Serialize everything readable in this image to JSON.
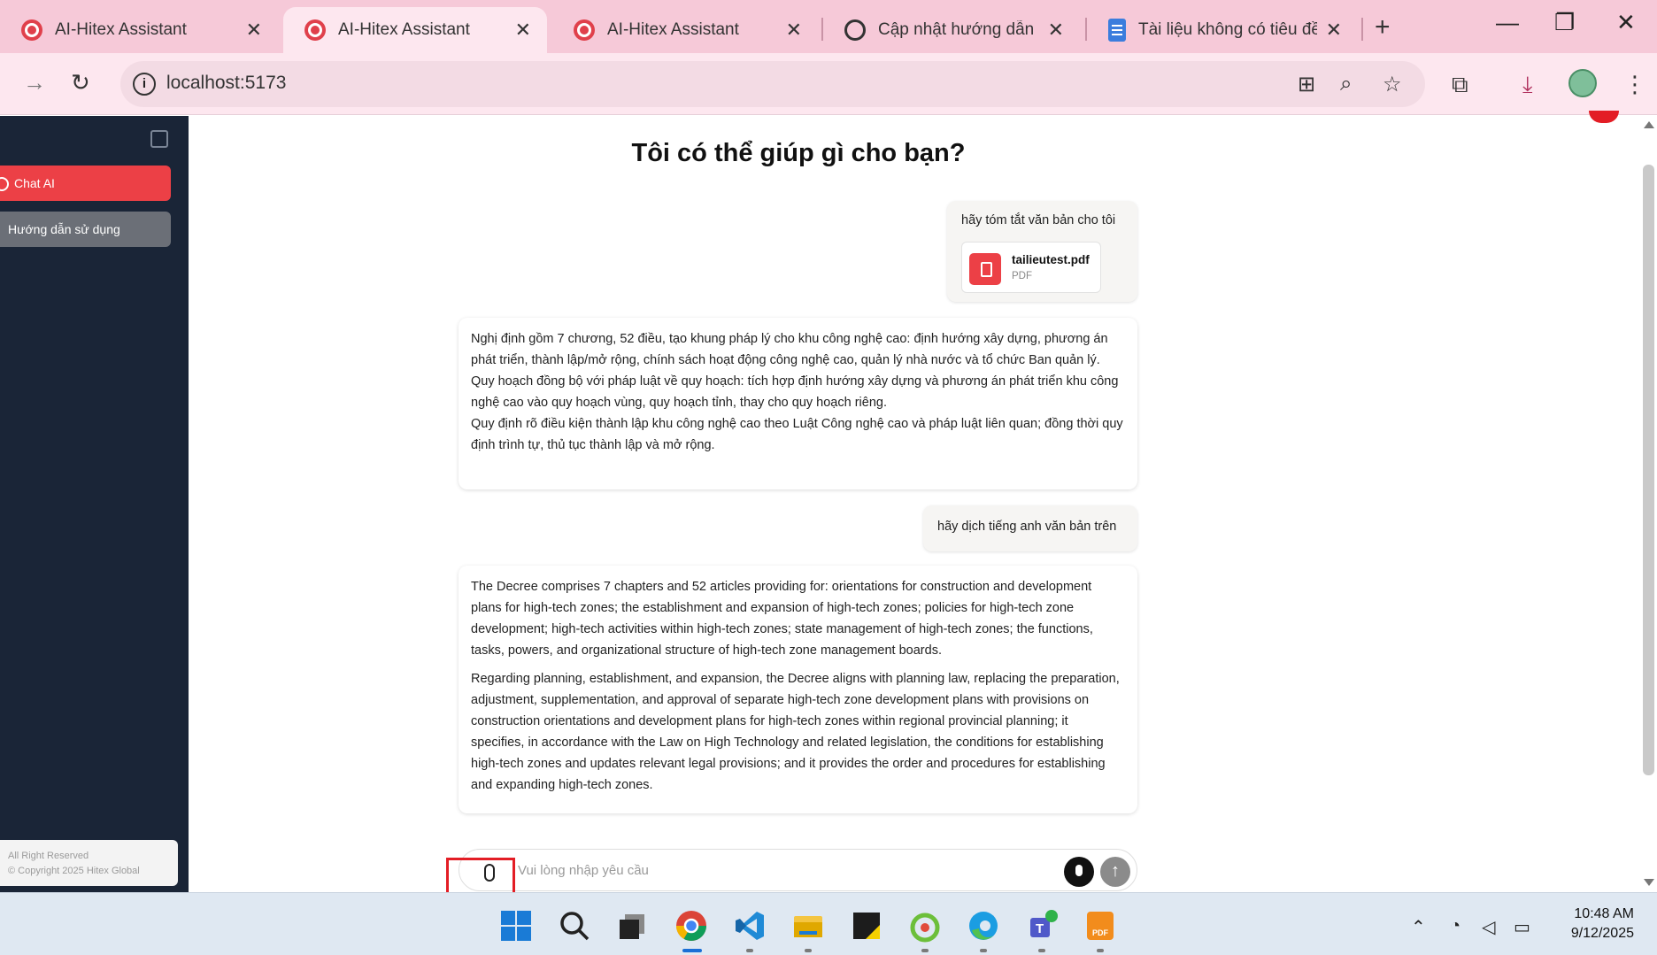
{
  "browser": {
    "tabs": [
      {
        "title": "AI-Hitex Assistant",
        "icon": "hitex-favicon",
        "active": false
      },
      {
        "title": "AI-Hitex Assistant",
        "icon": "hitex-favicon",
        "active": true
      },
      {
        "title": "AI-Hitex Assistant",
        "icon": "hitex-favicon",
        "active": false
      },
      {
        "title": "Cập nhật hướng dẫn nhiề",
        "icon": "chatgpt-favicon",
        "active": false
      },
      {
        "title": "Tài liệu không có tiêu đề",
        "icon": "google-docs-favicon",
        "active": false
      }
    ],
    "new_tab": "+",
    "window_controls": {
      "minimize": "—",
      "restore": "❐",
      "close": "✕"
    },
    "address": "localhost:5173",
    "colors": {
      "tab_strip": "#f6c9d8",
      "toolbar": "#fde7ef"
    }
  },
  "sidebar": {
    "items": [
      {
        "label": "Chat AI",
        "active": true
      },
      {
        "label": "Hướng dẫn sử dụng",
        "active": false
      }
    ],
    "footer": {
      "line1": "All Right Reserved",
      "line2": "© Copyright 2025 Hitex Global"
    },
    "colors": {
      "background": "#1a2537",
      "active": "#ec4046"
    }
  },
  "chat": {
    "heading": "Tôi có thể giúp gì cho bạn?",
    "messages": [
      {
        "role": "user",
        "text": "hãy tóm tắt văn bản cho tôi",
        "attachment": {
          "name": "tailieutest.pdf",
          "type": "PDF"
        }
      },
      {
        "role": "assistant",
        "paragraphs": [
          "Nghị định gồm 7 chương, 52 điều, tạo khung pháp lý cho khu công nghệ cao: định hướng xây dựng, phương án phát triển, thành lập/mở rộng, chính sách hoạt động công nghệ cao, quản lý nhà nước và tổ chức Ban quản lý.",
          "Quy hoạch đồng bộ với pháp luật về quy hoạch: tích hợp định hướng xây dựng và phương án phát triển khu công nghệ cao vào quy hoạch vùng, quy hoạch tỉnh, thay cho quy hoạch riêng.",
          "Quy định rõ điều kiện thành lập khu công nghệ cao theo Luật Công nghệ cao và pháp luật liên quan; đồng thời quy định trình tự, thủ tục thành lập và mở rộng."
        ]
      },
      {
        "role": "user",
        "text": "hãy dịch tiếng anh văn bản trên"
      },
      {
        "role": "assistant",
        "paragraphs": [
          "The Decree comprises 7 chapters and 52 articles providing for: orientations for construction and development plans for high-tech zones; the establishment and expansion of high-tech zones; policies for high-tech zone development; high-tech activities within high-tech zones; state management of high-tech zones; the functions, tasks, powers, and organizational structure of high-tech zone management boards.",
          "Regarding planning, establishment, and expansion, the Decree aligns with planning law, replacing the preparation, adjustment, supplementation, and approval of separate high-tech zone development plans with provisions on construction orientations and development plans for high-tech zones within regional provincial planning; it specifies, in accordance with the Law on High Technology and related legislation, the conditions for establishing high-tech zones and updates relevant legal provisions; and it provides the order and procedures for establishing and expanding high-tech zones."
        ]
      }
    ],
    "composer": {
      "placeholder": "Vui lòng nhập yêu cầu",
      "value": ""
    },
    "colors": {
      "accent": "#ec4046",
      "highlight_box": "#e31d25"
    }
  },
  "taskbar": {
    "apps": [
      "windows-start",
      "search",
      "task-view",
      "chrome",
      "vscode",
      "file-explorer",
      "sticky-notes",
      "app-green",
      "edge",
      "teams",
      "pdf-app"
    ],
    "clock": {
      "time": "10:48 AM",
      "date": "9/12/2025"
    }
  }
}
